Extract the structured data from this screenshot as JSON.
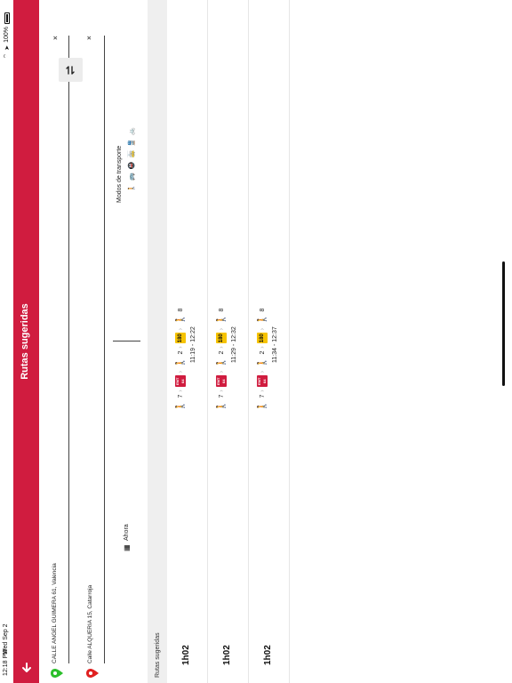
{
  "status": {
    "time": "12:18 PM",
    "date": "Wed Sep 2",
    "battery": "100%"
  },
  "header": {
    "title": "Rutas sugeridas"
  },
  "route": {
    "origin": "CALLE ANGEL GUIMERA 61, Valencia",
    "destination": "Calle ALQUERIA 15, Catarroja",
    "clear_symbol": "×",
    "when_label": "Ahora",
    "modes_label": "Modos de transporte",
    "modes": [
      "walk",
      "bus",
      "metro",
      "tram",
      "train",
      "bike"
    ]
  },
  "results": {
    "header": "Rutas sugeridas",
    "rows": [
      {
        "duration": "1h02",
        "times": "11:19 - 12:22",
        "walk1": "7",
        "bus": "64",
        "bus_operator": "EMT",
        "walk2": "2",
        "metro": "180",
        "walk3": "8"
      },
      {
        "duration": "1h02",
        "times": "11:29 - 12:32",
        "walk1": "7",
        "bus": "64",
        "bus_operator": "EMT",
        "walk2": "2",
        "metro": "180",
        "walk3": "8"
      },
      {
        "duration": "1h02",
        "times": "11:34 - 12:37",
        "walk1": "7",
        "bus": "64",
        "bus_operator": "EMT",
        "walk2": "2",
        "metro": "180",
        "walk3": "8"
      }
    ]
  },
  "colors": {
    "brand": "#d01c3f",
    "metro": "#f6c300",
    "origin_pin": "#2bbf2b",
    "dest_pin": "#e02020"
  }
}
